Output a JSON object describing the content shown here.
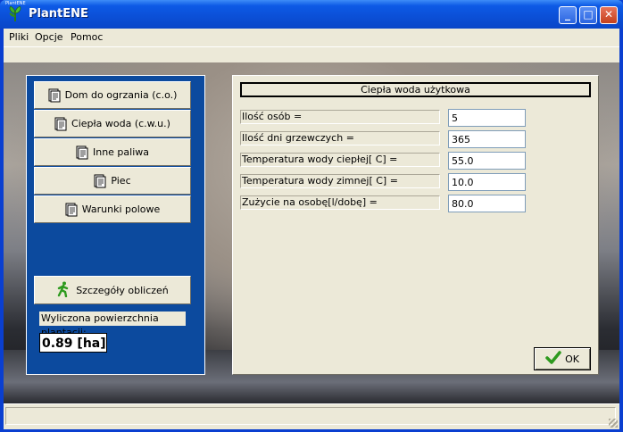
{
  "window": {
    "title": "PlantENE",
    "icon_caption": "PlantENE",
    "controls": {
      "minimize": "_",
      "maximize": "□",
      "close": "✕"
    }
  },
  "menu": [
    "Pliki",
    "Opcje",
    "Pomoc"
  ],
  "nav": {
    "buttons": [
      {
        "label": "Dom do ogrzania (c.o.)",
        "icon": "document-icon"
      },
      {
        "label": "Ciepła woda (c.w.u.)",
        "icon": "document-icon"
      },
      {
        "label": "Inne paliwa",
        "icon": "document-icon"
      },
      {
        "label": "Piec",
        "icon": "document-icon"
      },
      {
        "label": "Warunki polowe",
        "icon": "document-icon"
      }
    ],
    "details_button": "Szczegóły obliczeń",
    "area_label": "Wyliczona powierzchnia plantacji:",
    "area_value": "0.89 [ha]"
  },
  "form": {
    "title": "Ciepła woda użytkowa",
    "rows": [
      {
        "label": "Ilość osób =",
        "value": "5"
      },
      {
        "label": "Ilość dni grzewczych =",
        "value": "365"
      },
      {
        "label": "Temperatura wody ciepłej[ C] =",
        "value": "55.0"
      },
      {
        "label": "Temperatura wody zimnej[ C] =",
        "value": "10.0"
      },
      {
        "label": "Zużycie na osobę[l/dobę] =",
        "value": "80.0"
      }
    ],
    "ok_label": "OK"
  },
  "colors": {
    "titlebar": "#0b4fd6",
    "panel_blue": "#0c4a9e",
    "face": "#ece9d8",
    "ok_check": "#2e9a1e"
  }
}
